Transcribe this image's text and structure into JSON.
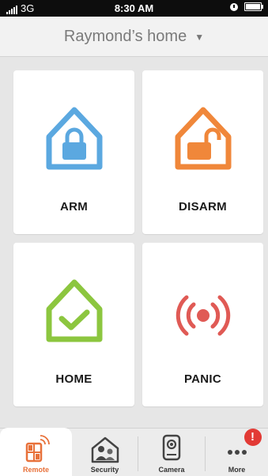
{
  "status_bar": {
    "carrier": "3G",
    "time": "8:30 AM"
  },
  "header": {
    "title": "Raymond’s home",
    "caret": "▼"
  },
  "tiles": [
    {
      "label": "ARM",
      "icon": "locked-house-icon",
      "color": "#5ba8e0"
    },
    {
      "label": "DISARM",
      "icon": "unlocked-house-icon",
      "color": "#f0873a"
    },
    {
      "label": "HOME",
      "icon": "check-house-icon",
      "color": "#8cc63f"
    },
    {
      "label": "PANIC",
      "icon": "panic-signal-icon",
      "color": "#e05a55"
    }
  ],
  "tab_bar": {
    "accent": "#e8713a",
    "tabs": [
      {
        "label": "Remote",
        "icon": "remote-icon",
        "active": true
      },
      {
        "label": "Security",
        "icon": "security-icon",
        "active": false
      },
      {
        "label": "Camera",
        "icon": "camera-icon",
        "active": false
      },
      {
        "label": "More",
        "icon": "more-icon",
        "active": false,
        "badge": "!"
      }
    ]
  }
}
